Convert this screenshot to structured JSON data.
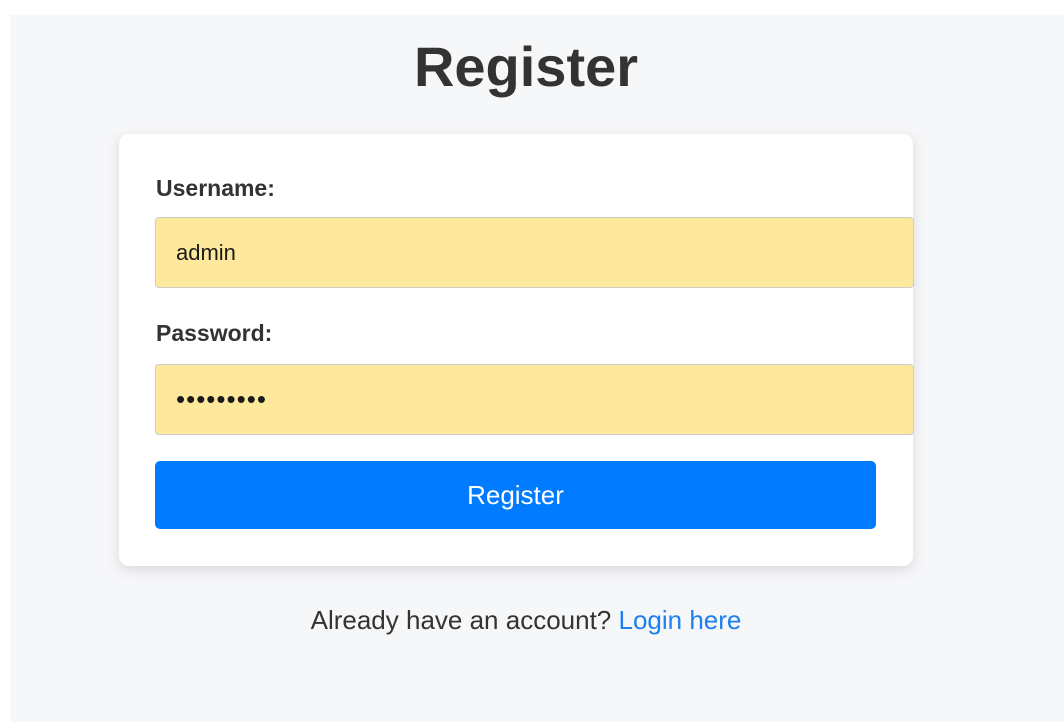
{
  "page": {
    "title": "Register"
  },
  "form": {
    "username_label": "Username:",
    "username_value": "admin",
    "password_label": "Password:",
    "password_value": "123456789",
    "submit_label": "Register"
  },
  "footer": {
    "prompt_text": "Already have an account?",
    "login_link_text": "Login here"
  },
  "colors": {
    "page_background": "#f6f7f9",
    "autofill_background": "#fde89b",
    "primary_button": "#007bff",
    "link": "#1e7ff0"
  }
}
